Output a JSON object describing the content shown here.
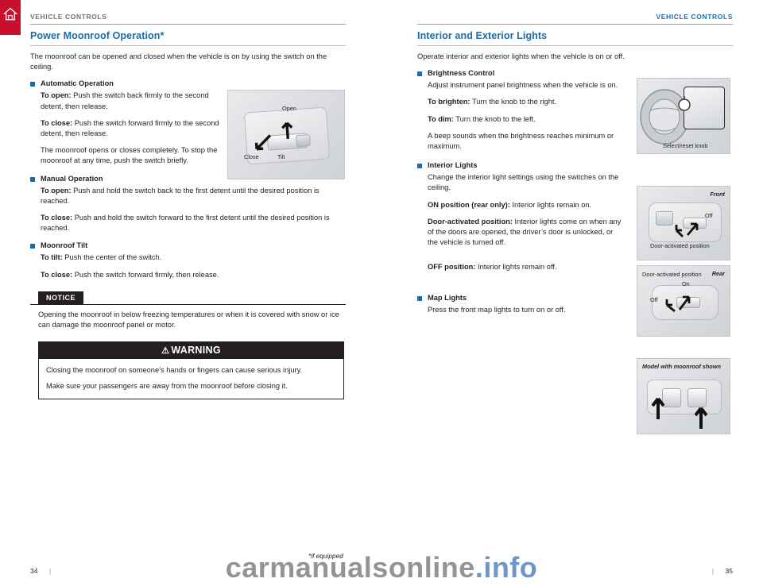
{
  "header": {
    "left_label": "VEHICLE CONTROLS",
    "right_label": "VEHICLE CONTROLS"
  },
  "footer": {
    "left_page": "34",
    "right_page": "35",
    "divider": "|",
    "if_equipped": "*if equipped"
  },
  "watermark": {
    "part1": "carmanualsonline",
    "part2": ".info"
  },
  "left_column": {
    "title": "Power Moonroof Operation*",
    "intro": "The moonroof can be opened and closed when the vehicle is on by using the switch on the ceiling.",
    "sections": [
      {
        "heading": "Automatic Operation",
        "paragraphs": [
          {
            "label": "To open:",
            "text": " Push the switch back firmly to the second detent, then release."
          },
          {
            "label": "To close:",
            "text": " Push the switch forward firmly to the second detent, then release."
          },
          {
            "label": "",
            "text": "The moonroof opens or closes completely. To stop the moonroof at any time, push the switch briefly."
          }
        ]
      },
      {
        "heading": "Manual Operation",
        "paragraphs": [
          {
            "label": "To open:",
            "text": " Push and hold the switch back to the first detent until the desired position is reached."
          },
          {
            "label": "To close:",
            "text": " Push and hold the switch forward to the first detent until the desired position is reached."
          }
        ]
      },
      {
        "heading": "Moonroof Tilt",
        "paragraphs": [
          {
            "label": "To tilt:",
            "text": " Push the center of the switch."
          },
          {
            "label": "To close:",
            "text": " Push the switch forward firmly, then release."
          }
        ]
      }
    ],
    "notice": {
      "tag": "NOTICE",
      "body": "Opening the moonroof in below freezing temperatures or when it is covered with snow or ice can damage the moonroof panel or motor."
    },
    "warning": {
      "title": "WARNING",
      "symbol": "⚠",
      "lines": [
        "Closing the moonroof on someone’s hands or fingers can cause serious injury.",
        "Make sure your passengers are away from the moonroof before closing it."
      ]
    },
    "illustration": {
      "label_open": "Open",
      "label_close": "Close",
      "label_tilt": "Tilt"
    }
  },
  "right_column": {
    "title": "Interior and Exterior Lights",
    "intro": "Operate interior and exterior lights when the vehicle is on or off.",
    "sections": [
      {
        "heading": "Brightness Control",
        "paragraphs": [
          {
            "label": "",
            "text": "Adjust instrument panel brightness when the vehicle is on."
          },
          {
            "label": "To brighten:",
            "text": " Turn the knob to the right."
          },
          {
            "label": "To dim:",
            "text": " Turn the knob to the left."
          },
          {
            "label": "",
            "text": "A beep sounds when the brightness reaches minimum or maximum."
          }
        ]
      },
      {
        "heading": "Interior Lights",
        "paragraphs": [
          {
            "label": "",
            "text": "Change the interior light settings using the switches on the ceiling."
          },
          {
            "label": "ON position (rear only):",
            "text": " Interior lights remain on."
          },
          {
            "label": "Door-activated position:",
            "text": " Interior lights come on when any of the doors are opened, the driver’s door is unlocked, or the vehicle is turned off."
          },
          {
            "label": "OFF position:",
            "text": " Interior lights remain off."
          }
        ]
      },
      {
        "heading": "Map Lights",
        "paragraphs": [
          {
            "label": "",
            "text": "Press the front map lights to turn on or off."
          }
        ]
      }
    ],
    "illustrations": {
      "brightness": {
        "caption": "Select/reset knob"
      },
      "interior_front": {
        "position": "Front",
        "label_off": "Off",
        "label_door": "Door-activated position"
      },
      "interior_rear": {
        "position": "Rear",
        "label_on": "On",
        "label_off": "Off",
        "label_door": "Door-activated position"
      },
      "map_lights": {
        "caption": "Model with moonroof shown"
      }
    }
  }
}
